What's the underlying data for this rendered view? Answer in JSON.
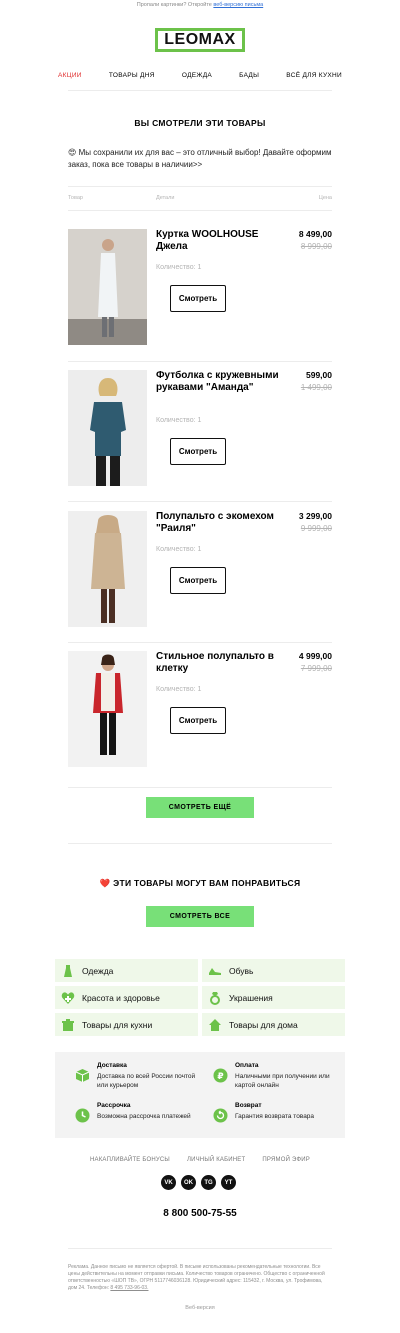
{
  "preheader": {
    "text": "Пропали картинки? Откройте",
    "link": "веб-версию письма"
  },
  "logo": "LEOMAX",
  "nav": [
    "АКЦИИ",
    "ТОВАРЫ ДНЯ",
    "ОДЕЖДА",
    "БАДЫ",
    "ВСЁ ДЛЯ КУХНИ"
  ],
  "viewed": {
    "title": "ВЫ СМОТРЕЛИ ЭТИ ТОВАРЫ",
    "intro": "😍 Мы сохранили их для вас – это отличный выбор! Давайте оформим заказ, пока все товары в наличии>>",
    "columns": [
      "Товар",
      "Детали",
      "Цена"
    ]
  },
  "products": [
    {
      "name": "Куртка WOOLHOUSE Джела",
      "qty": "Количество: 1",
      "price": "8 499,00",
      "old_price": "8 999,00",
      "button": "Смотреть"
    },
    {
      "name": "Футболка с кружевными рукавами \"Аманда\"",
      "qty": "Количество: 1",
      "price": "599,00",
      "old_price": "1 499,00",
      "button": "Смотреть"
    },
    {
      "name": "Полупальто с экомехом \"Раиля\"",
      "qty": "Количество: 1",
      "price": "3 299,00",
      "old_price": "9 999,00",
      "button": "Смотреть"
    },
    {
      "name": "Стильное полупальто в клетку",
      "qty": "Количество: 1",
      "price": "4 999,00",
      "old_price": "7 999,00",
      "button": "Смотреть"
    }
  ],
  "more_button": "СМОТРЕТЬ ЕЩЁ",
  "recommend": {
    "title": "❤️ ЭТИ ТОВАРЫ МОГУТ ВАМ ПОНРАВИТЬСЯ",
    "button": "СМОТРЕТЬ ВСЕ"
  },
  "categories": [
    "Одежда",
    "Обувь",
    "Красота и здоровье",
    "Украшения",
    "Товары для кухни",
    "Товары для дома"
  ],
  "info": [
    {
      "title": "Доставка",
      "text": "Доставка по всей России почтой или курьером"
    },
    {
      "title": "Оплата",
      "text": "Наличными при получении или картой онлайн"
    },
    {
      "title": "Рассрочка",
      "text": "Возможна рассрочка платежей"
    },
    {
      "title": "Возврат",
      "text": "Гарантия возврата товара"
    }
  ],
  "footer_links": [
    "НАКАПЛИВАЙТЕ БОНУСЫ",
    "ЛИЧНЫЙ КАБИНЕТ",
    "ПРЯМОЙ ЭФИР"
  ],
  "socials": [
    "VK",
    "OK",
    "TG",
    "YT"
  ],
  "phone": "8 800 500-75-55",
  "legal": {
    "text": "Реклама. Данное письмо не является офертой. В письме использованы рекомендательные технологии. Все цены действительны на момент отправки письма. Количество товаров ограничено. Общество с ограниченной ответственностью «ШОП ТВ», ОГРН 5117746036128. Юридический адрес: 115432, г. Москва, ул. Трофимова, дом 24. Телефон:",
    "phone": "8 495 733-96-03."
  },
  "web_version": "Веб-версия",
  "colors": {
    "accent_green": "#78e078",
    "logo_green": "#6cc24a",
    "nav_active": "#e02d2d",
    "category_bg": "#eff8e9",
    "icon_green": "#6cc24a"
  }
}
